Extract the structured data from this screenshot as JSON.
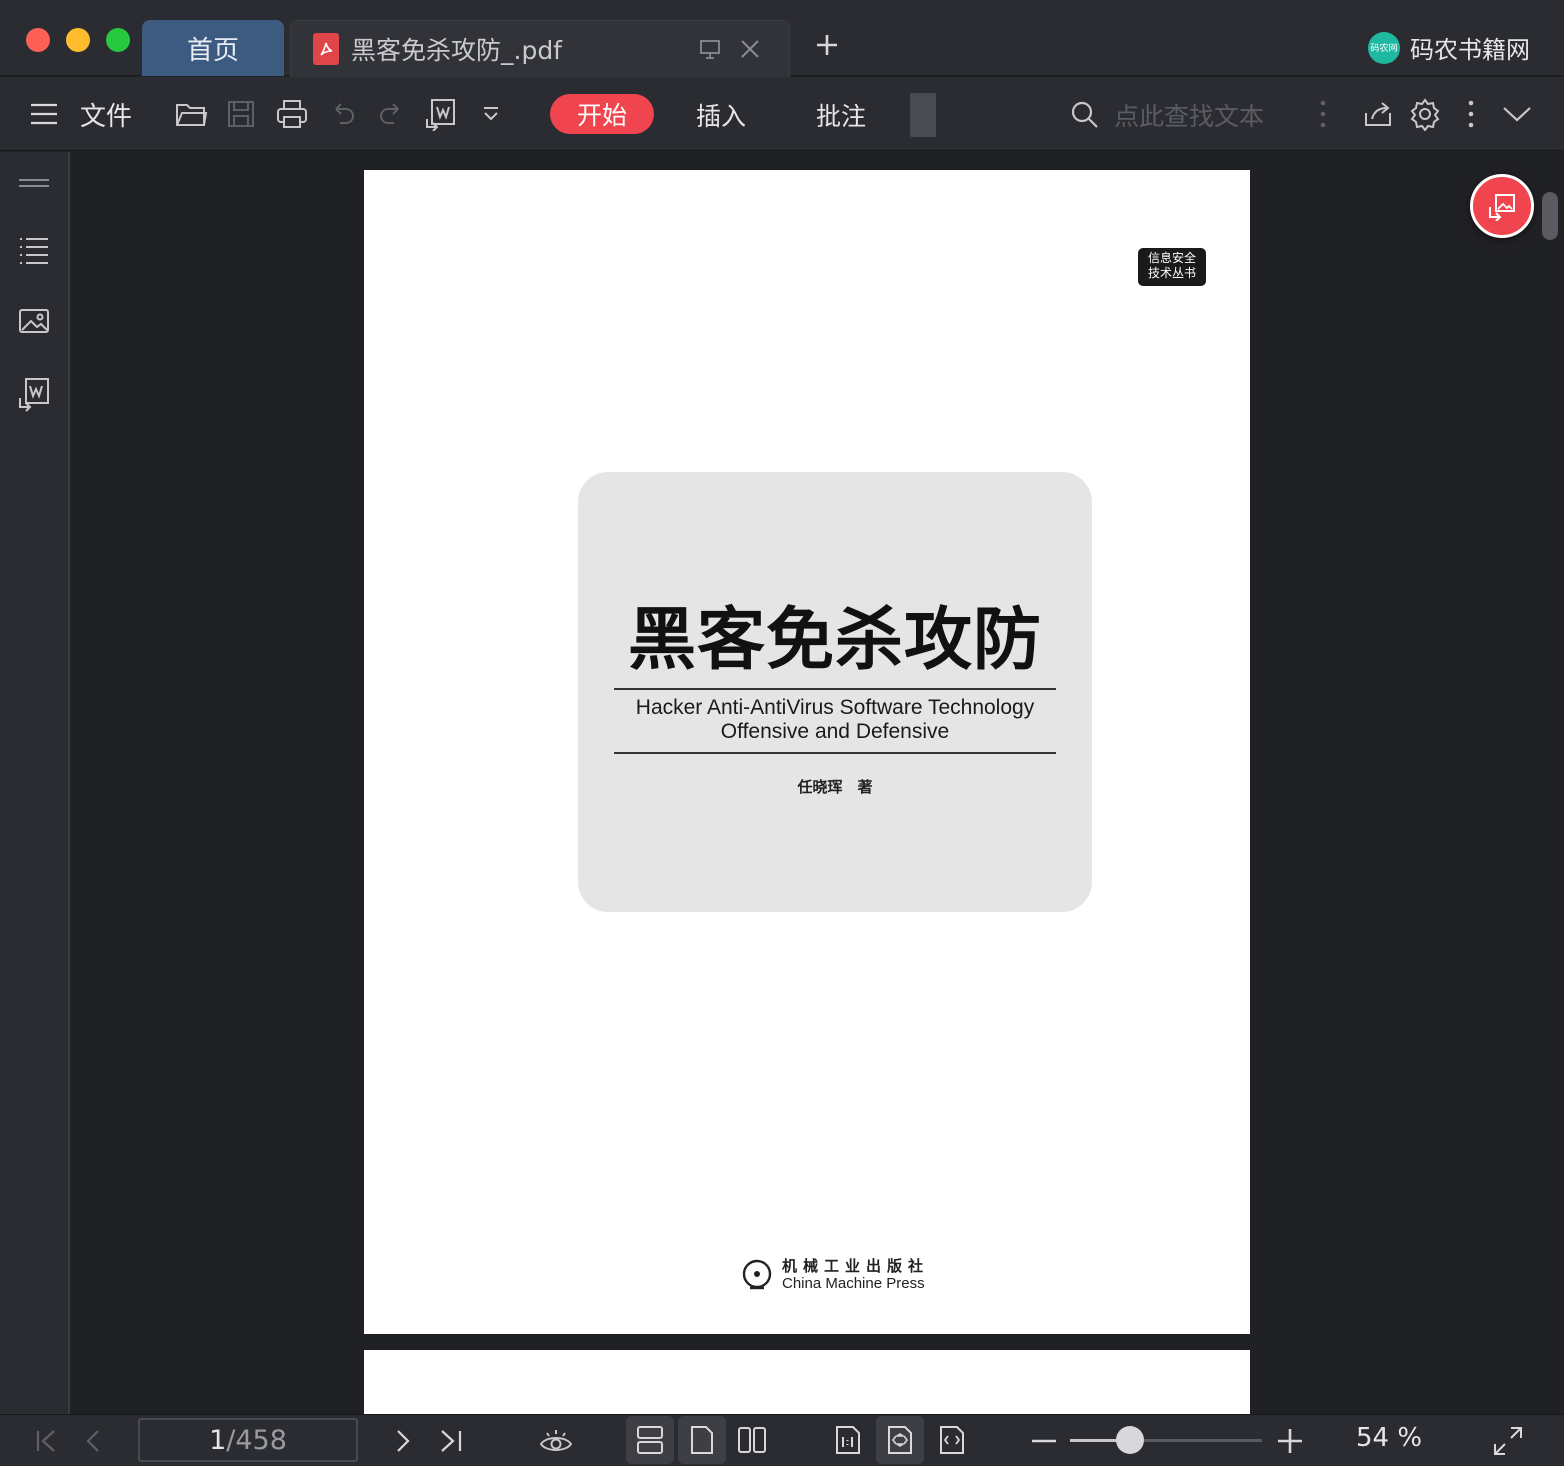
{
  "tabs": {
    "home_label": "首页",
    "doc_title": "黑客免杀攻防_.pdf"
  },
  "brand": {
    "name": "码农书籍网",
    "logo_text": "码农网"
  },
  "toolbar": {
    "file_menu": "文件",
    "ribbon_tabs": [
      "开始",
      "插入",
      "批注"
    ],
    "active_tab": "开始",
    "search_placeholder": "点此查找文本"
  },
  "document": {
    "series_badge": "信息安全\n技术丛书",
    "cover_title": "黑客免杀攻防",
    "cover_subtitle_line1": "Hacker Anti-AntiVirus Software Technology",
    "cover_subtitle_line2": "Offensive and Defensive",
    "author": "任晓珲　著",
    "publisher_zh": "机械工业出版社",
    "publisher_en": "China Machine Press"
  },
  "status": {
    "current_page": "1",
    "total_pages": "/458",
    "zoom": "54 %",
    "zoom_level": 0.31
  },
  "colors": {
    "accent": "#f0454f",
    "home_tab": "#3d5a80"
  }
}
